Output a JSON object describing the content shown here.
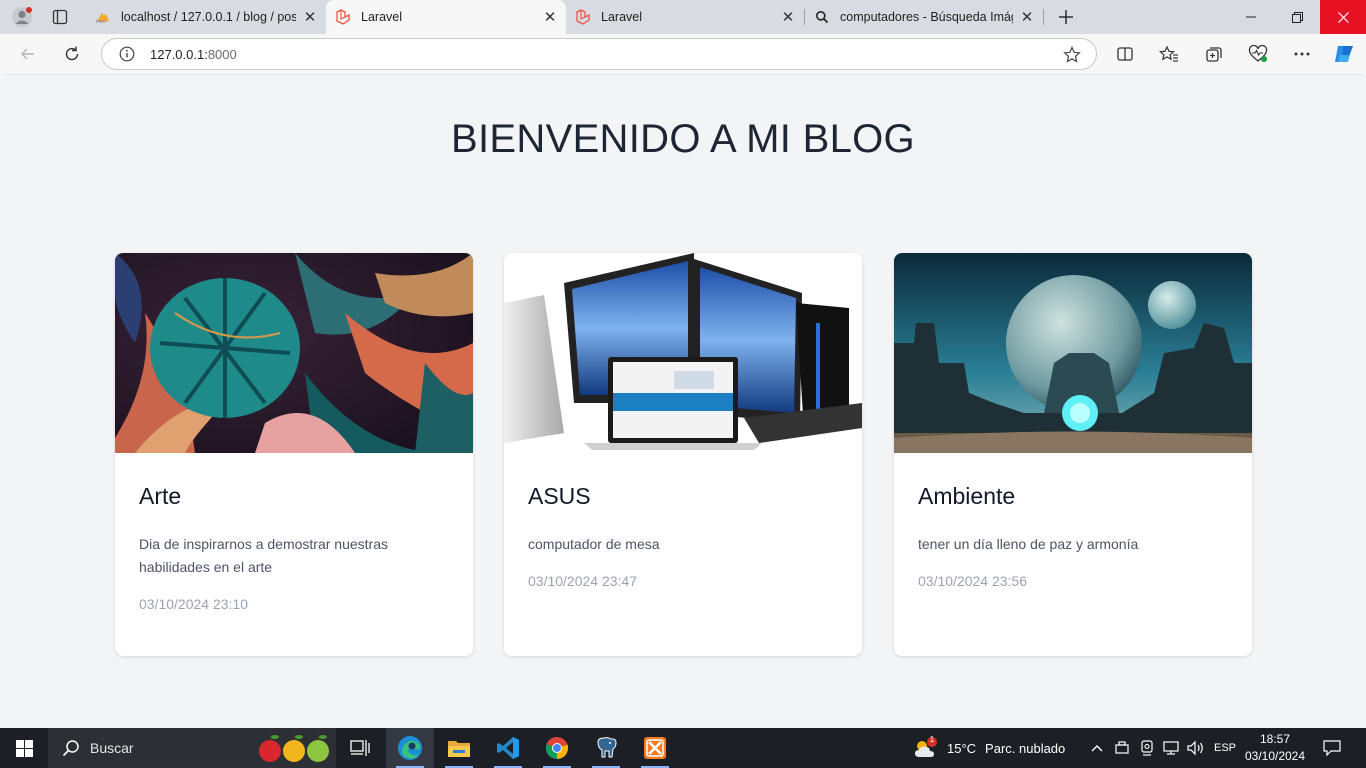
{
  "browser": {
    "tabs": [
      {
        "title": "localhost / 127.0.0.1 / blog / posts",
        "favicon": "phpmyadmin-icon",
        "active": false
      },
      {
        "title": "Laravel",
        "favicon": "laravel-icon",
        "active": true
      },
      {
        "title": "Laravel",
        "favicon": "laravel-icon",
        "active": false
      },
      {
        "title": "computadores - Búsqueda Imágenes",
        "favicon": "search-icon",
        "active": false
      }
    ],
    "address": {
      "host": "127.0.0.1:",
      "port": "8000"
    }
  },
  "page": {
    "heading": "BIENVENIDO A MI BLOG",
    "posts": [
      {
        "title": "Arte",
        "description": "Dia de inspirarnos a demostrar nuestras habilidades en el arte",
        "date": "03/10/2024 23:10",
        "image": "tropical-leaves-image"
      },
      {
        "title": "ASUS",
        "description": "computador de mesa",
        "date": "03/10/2024 23:47",
        "image": "computers-image"
      },
      {
        "title": "Ambiente",
        "description": "tener un día lleno de paz y armonía",
        "date": "03/10/2024 23:56",
        "image": "sci-fi-planet-image"
      }
    ]
  },
  "taskbar": {
    "search_placeholder": "Buscar",
    "weather": {
      "temp": "15°C",
      "text": "Parc. nublado",
      "badge": "1"
    },
    "lang": "ESP",
    "time": "18:57",
    "date": "03/10/2024"
  },
  "colors": {
    "accent": "#0067c0",
    "close_red": "#e81123",
    "laravel_red": "#f05340"
  }
}
